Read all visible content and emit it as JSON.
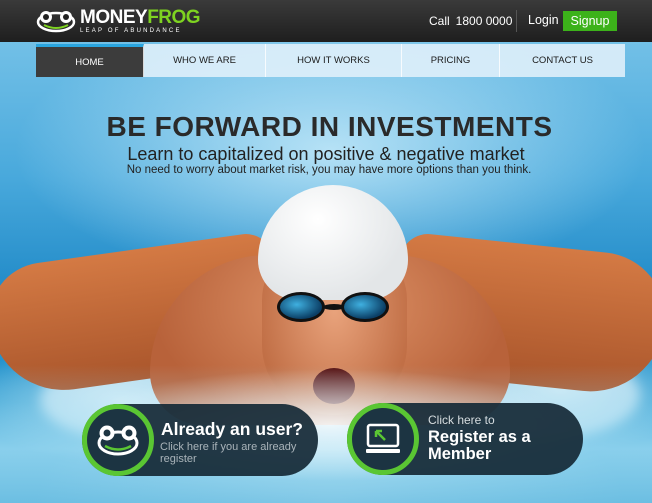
{
  "brand": {
    "name_part1": "MONEY",
    "name_part2": "FROG",
    "tagline": "LEAP OF ABUNDANCE"
  },
  "header": {
    "call_label": "Call",
    "phone": "1800 0000",
    "login_label": "Login",
    "signup_label": "Signup"
  },
  "nav": {
    "items": [
      {
        "label": "HOME",
        "active": true
      },
      {
        "label": "WHO WE ARE",
        "active": false
      },
      {
        "label": "HOW IT WORKS",
        "active": false
      },
      {
        "label": "PRICING",
        "active": false
      },
      {
        "label": "CONTACT US",
        "active": false
      }
    ]
  },
  "hero": {
    "headline": "BE FORWARD IN INVESTMENTS",
    "subheadline": "Learn to capitalized on positive & negative market",
    "description": "No need to worry about market risk, you may have more options than you think."
  },
  "cta_user": {
    "title": "Already an user?",
    "subtitle": "Click here if you are already register",
    "icon": "frog-icon"
  },
  "cta_member": {
    "pre_label": "Click here to",
    "title": "Register as a Member",
    "icon": "monitor-icon"
  },
  "colors": {
    "brand_green": "#7ed321",
    "signup_green": "#3cb21a",
    "nav_active_bg": "#3c3c3c",
    "nav_active_accent": "#2aa6e0",
    "cta_bg": "#162a37",
    "cta_ring": "#5ac633"
  }
}
